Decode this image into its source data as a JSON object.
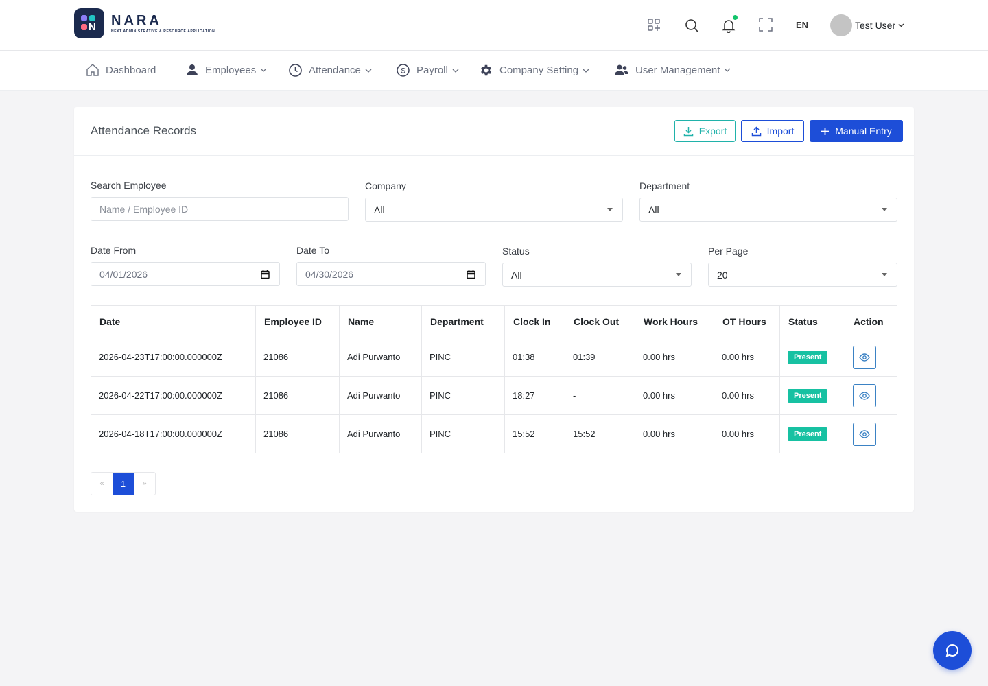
{
  "brand": {
    "title": "NARA",
    "subtitle": "NEXT ADMINISTRATIVE & RESOURCE APPLICATION",
    "logo_letter": "N"
  },
  "topbar": {
    "icons": [
      "apps-icon",
      "search-icon",
      "bell-icon",
      "fullscreen-icon"
    ],
    "language": "EN",
    "user_name": "Test User",
    "notification_dot_color": "#12c46b"
  },
  "nav": {
    "items": [
      {
        "label": "Dashboard",
        "icon": "home-icon",
        "has_dropdown": false
      },
      {
        "label": "Employees",
        "icon": "person-icon",
        "has_dropdown": true
      },
      {
        "label": "Attendance",
        "icon": "clock-icon",
        "has_dropdown": true
      },
      {
        "label": "Payroll",
        "icon": "dollar-icon",
        "has_dropdown": true
      },
      {
        "label": "Company Setting",
        "icon": "gear-icon",
        "has_dropdown": true
      },
      {
        "label": "User Management",
        "icon": "users-icon",
        "has_dropdown": true
      }
    ]
  },
  "card": {
    "title": "Attendance Records",
    "buttons": {
      "export": "Export",
      "import": "Import",
      "manual_entry": "Manual Entry"
    }
  },
  "filters": {
    "search": {
      "label": "Search Employee",
      "placeholder": "Name / Employee ID",
      "value": ""
    },
    "company": {
      "label": "Company",
      "value": "All"
    },
    "department": {
      "label": "Department",
      "value": "All"
    },
    "date_from": {
      "label": "Date From",
      "value": "04/01/2026"
    },
    "date_to": {
      "label": "Date To",
      "value": "04/30/2026"
    },
    "status": {
      "label": "Status",
      "value": "All"
    },
    "per_page": {
      "label": "Per Page",
      "value": "20"
    }
  },
  "table": {
    "columns": [
      "Date",
      "Employee ID",
      "Name",
      "Department",
      "Clock In",
      "Clock Out",
      "Work Hours",
      "OT Hours",
      "Status",
      "Action"
    ],
    "rows": [
      {
        "date": "2026-04-23T17:00:00.000000Z",
        "employee_id": "21086",
        "name": "Adi Purwanto",
        "department": "PINC",
        "clock_in": "01:38",
        "clock_out": "01:39",
        "work_hours": "0.00 hrs",
        "ot_hours": "0.00 hrs",
        "status": "Present"
      },
      {
        "date": "2026-04-22T17:00:00.000000Z",
        "employee_id": "21086",
        "name": "Adi Purwanto",
        "department": "PINC",
        "clock_in": "18:27",
        "clock_out": "-",
        "work_hours": "0.00 hrs",
        "ot_hours": "0.00 hrs",
        "status": "Present"
      },
      {
        "date": "2026-04-18T17:00:00.000000Z",
        "employee_id": "21086",
        "name": "Adi Purwanto",
        "department": "PINC",
        "clock_in": "15:52",
        "clock_out": "15:52",
        "work_hours": "0.00 hrs",
        "ot_hours": "0.00 hrs",
        "status": "Present"
      }
    ]
  },
  "pagination": {
    "prev": "«",
    "current": "1",
    "next": "»"
  },
  "colors": {
    "primary": "#1d4ed8",
    "teal": "#20b2aa",
    "badge_present": "#17c1a2",
    "brand_dark": "#1b2a4e"
  }
}
